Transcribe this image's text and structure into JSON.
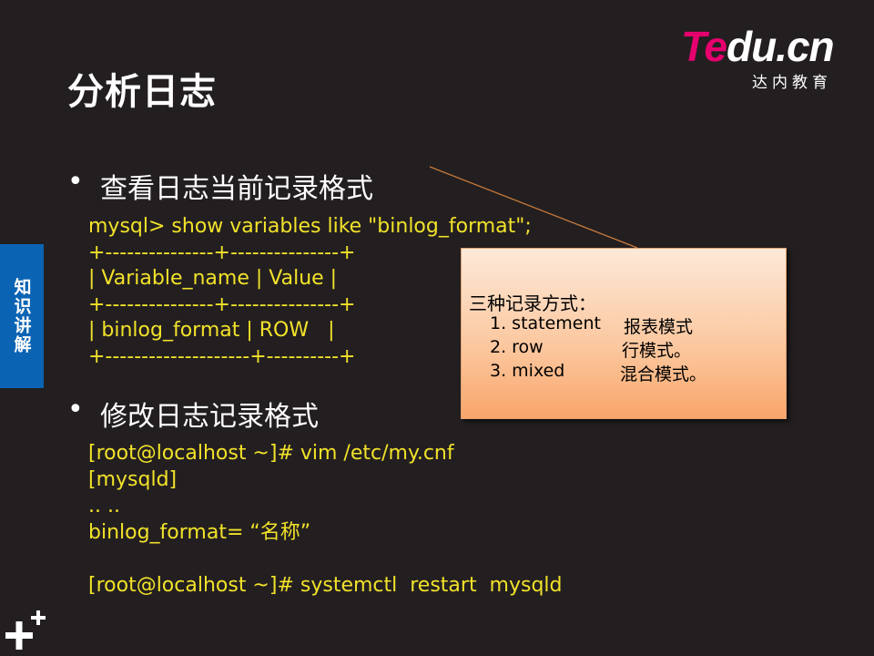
{
  "title": "分析日志",
  "logo": {
    "brand_colored": "Te",
    "brand_white": "du.cn",
    "tagline": "达内教育"
  },
  "side_tab": "知识讲解",
  "bullets": [
    {
      "dot": "•",
      "text": "查看日志当前记录格式"
    },
    {
      "dot": "•",
      "text": "修改日志记录格式"
    }
  ],
  "code_block_1": [
    "mysql> show variables like \"binlog_format\";",
    "+---------------+---------------+",
    "| Variable_name | Value |",
    "+---------------+---------------+",
    "| binlog_format | ROW   |",
    "+--------------------+----------+"
  ],
  "code_block_2": [
    "[root@localhost ~]# vim /etc/my.cnf",
    "[mysqld]",
    ".. ..",
    "binlog_format= “名称”",
    "",
    "[root@localhost ~]# systemctl  restart  mysqld"
  ],
  "callout": {
    "heading": "三种记录方式：",
    "items": [
      {
        "name": "1. statement",
        "desc": "报表模式"
      },
      {
        "name": "2. row",
        "desc": "行模式。"
      },
      {
        "name": "3. mixed",
        "desc": "混合模式。"
      }
    ]
  },
  "colors": {
    "background": "#231f20",
    "code_text": "#f2e22a",
    "logo_accent": "#e5006e",
    "side_tab": "#0b64b3",
    "callout_fill": "#fbc69c"
  }
}
